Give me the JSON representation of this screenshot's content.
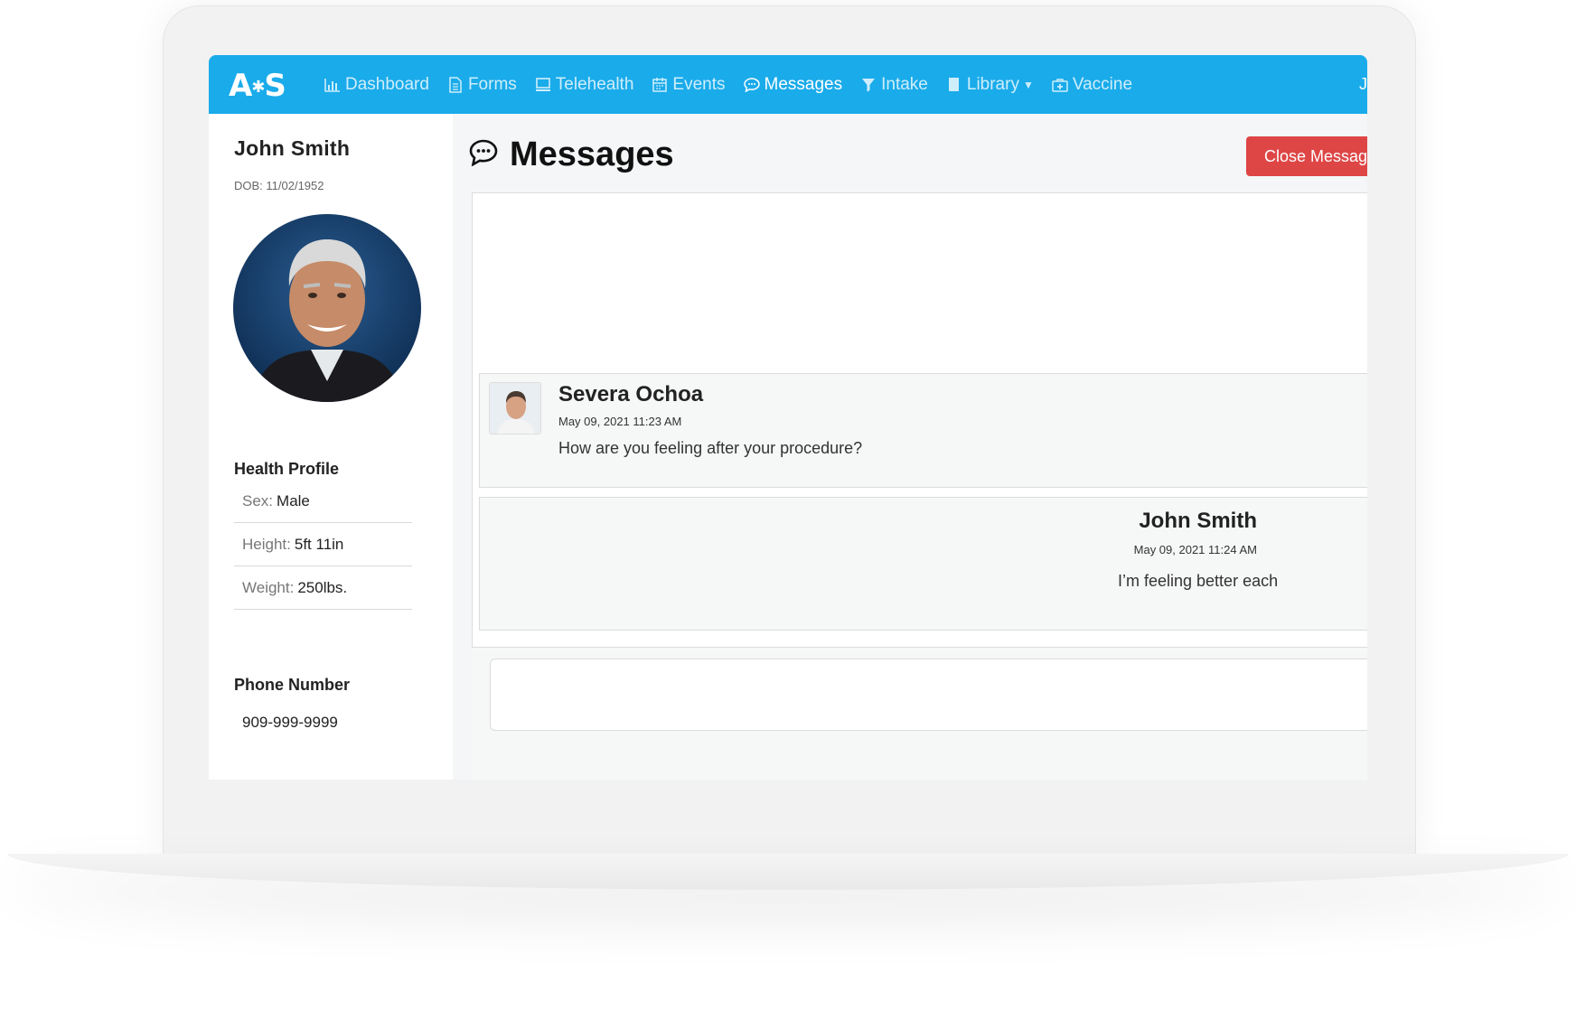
{
  "brand": {
    "logo": "A S"
  },
  "nav": {
    "items": [
      {
        "label": "Dashboard",
        "icon": "bar-chart-icon"
      },
      {
        "label": "Forms",
        "icon": "document-icon"
      },
      {
        "label": "Telehealth",
        "icon": "monitor-icon"
      },
      {
        "label": "Events",
        "icon": "calendar-icon"
      },
      {
        "label": "Messages",
        "icon": "chat-bubble-icon",
        "active": true
      },
      {
        "label": "Intake",
        "icon": "funnel-icon"
      },
      {
        "label": "Library",
        "icon": "book-icon",
        "dropdown": true
      },
      {
        "label": "Vaccine",
        "icon": "medical-kit-icon"
      }
    ],
    "user_initial": "J"
  },
  "patient": {
    "name": "John  Smith",
    "dob": "DOB: 11/02/1952",
    "health_profile_title": "Health Profile",
    "profile": [
      {
        "label": "Sex:",
        "value": "Male"
      },
      {
        "label": "Height:",
        "value": "5ft 11in"
      },
      {
        "label": "Weight:",
        "value": "250lbs."
      }
    ],
    "phone_title": "Phone Number",
    "phone": "909-999-9999"
  },
  "messages_page": {
    "title": "Messages",
    "close_button": "Close Messag",
    "messages": [
      {
        "sender": "Severa Ochoa",
        "time": "May 09, 2021 11:23 AM",
        "text": "How are you feeling after your procedure?"
      },
      {
        "sender": "John Smith",
        "time": "May 09, 2021 11:24 AM",
        "text": "I’m feeling better each"
      }
    ]
  },
  "colors": {
    "nav": "#1aabea",
    "close_button": "#de4646"
  }
}
